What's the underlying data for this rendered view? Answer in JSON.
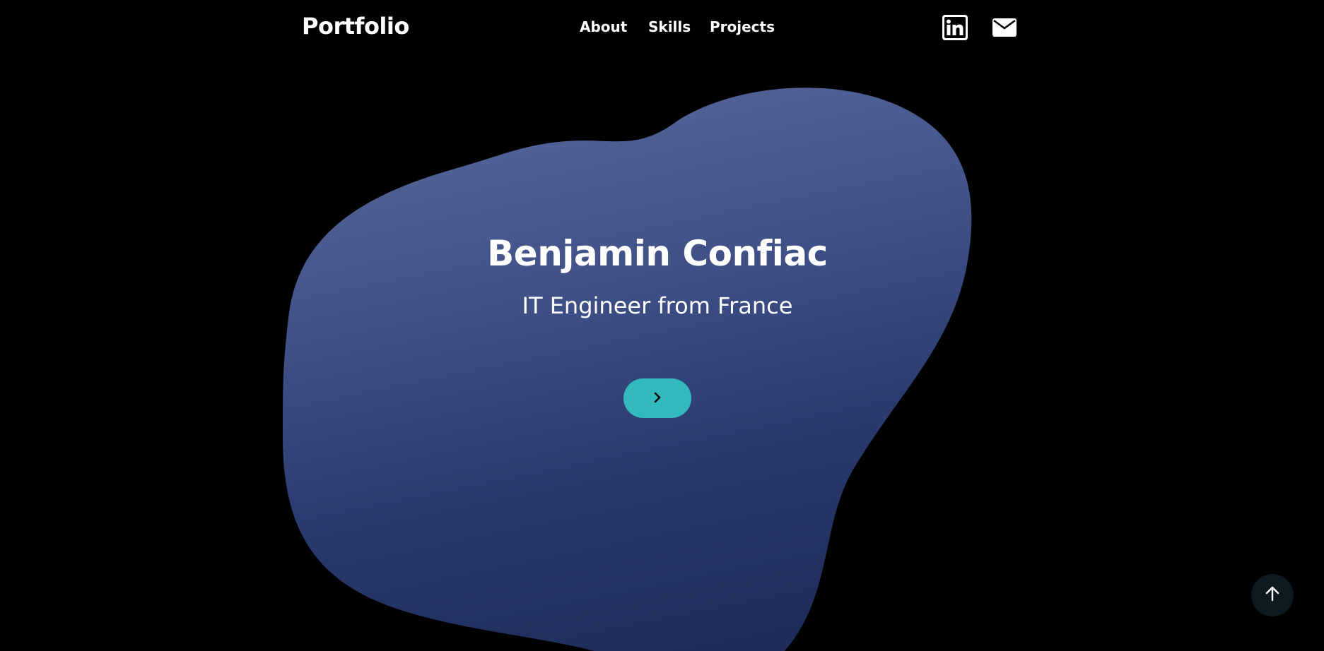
{
  "header": {
    "brand": "Portfolio",
    "nav": [
      {
        "label": "About"
      },
      {
        "label": "Skills"
      },
      {
        "label": "Projects"
      }
    ],
    "social": [
      {
        "name": "linkedin-icon"
      },
      {
        "name": "mail-icon"
      }
    ]
  },
  "hero": {
    "title": "Benjamin Confiac",
    "subtitle": "IT Engineer from France",
    "cta_icon": "chevron-right-icon"
  },
  "floating": {
    "back_to_top_icon": "arrow-up-icon"
  },
  "colors": {
    "background": "#000000",
    "blob_top": "#4f5f8e",
    "blob_bottom": "#1f2d5c",
    "accent": "#31b9bd",
    "back_to_top_bg": "#0d1a22"
  }
}
